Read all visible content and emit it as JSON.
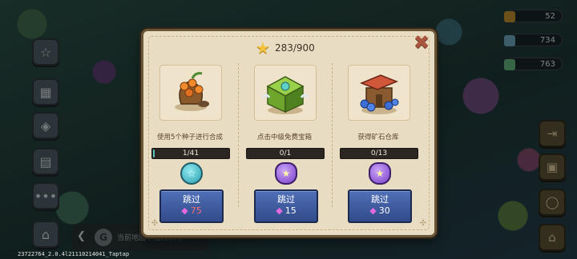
{
  "dialog": {
    "progress": "283/900",
    "progress_value": 283,
    "progress_max": 900,
    "tasks": [
      {
        "label": "使用5个种子进行合成",
        "progress_text": "1/41",
        "progress_fraction": 0.024,
        "reward_icon": "teal-coin-icon",
        "skip_label": "跳过",
        "skip_cost": "75",
        "skip_cost_color": "#ff6d6d"
      },
      {
        "label": "点击中级免费宝箱",
        "progress_text": "0/1",
        "progress_fraction": 0,
        "reward_icon": "purple-star-pouch-icon",
        "skip_label": "跳过",
        "skip_cost": "15",
        "skip_cost_color": "#ffffff"
      },
      {
        "label": "获得矿石仓库",
        "progress_text": "0/13",
        "progress_fraction": 0,
        "reward_icon": "purple-star-pouch-icon",
        "skip_label": "跳过",
        "skip_cost": "30",
        "skip_cost_color": "#ffffff"
      }
    ]
  },
  "hud": {
    "resources": [
      "52",
      "734",
      "763"
    ]
  },
  "footer": {
    "notice": "当前地图中任何瞬间",
    "version": "23722764_2.0.4l21110214041_Taptap"
  },
  "colors": {
    "dialog_bg": "#e8dcc2",
    "skip_button": "#324b8a",
    "bar_fill": "#5bc6b8",
    "star": "#f2c23a"
  }
}
